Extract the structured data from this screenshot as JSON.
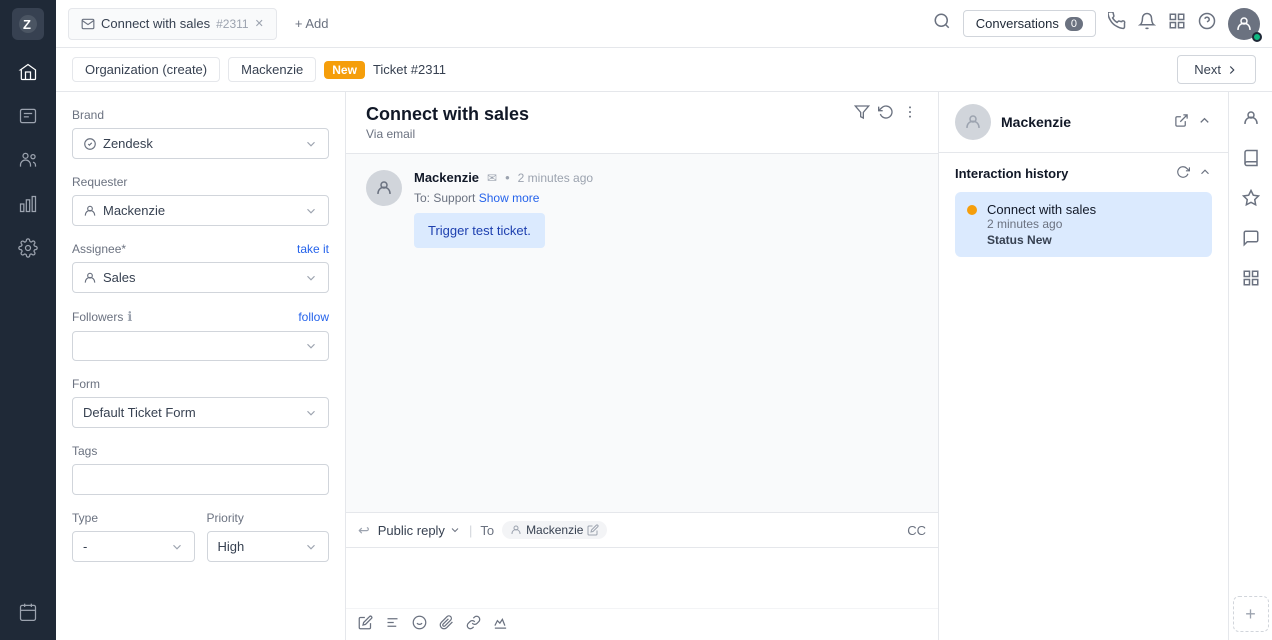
{
  "nav": {
    "logo": "Z",
    "icons": [
      "🏠",
      "📋",
      "👥",
      "📊",
      "⚙️",
      "📅"
    ]
  },
  "topbar": {
    "tab_title": "Connect with sales",
    "tab_id": "#2311",
    "add_label": "+ Add",
    "conversations_label": "Conversations",
    "conversations_count": "0"
  },
  "breadcrumb": {
    "org": "Organization (create)",
    "user": "Mackenzie",
    "status_badge": "New",
    "ticket": "Ticket #2311",
    "next_label": "Next"
  },
  "left_panel": {
    "brand_label": "Brand",
    "brand_value": "Zendesk",
    "requester_label": "Requester",
    "requester_value": "Mackenzie",
    "assignee_label": "Assignee*",
    "take_it_label": "take it",
    "assignee_value": "Sales",
    "followers_label": "Followers",
    "follow_label": "follow",
    "form_label": "Form",
    "form_value": "Default Ticket Form",
    "tags_label": "Tags",
    "type_label": "Type",
    "type_value": "-",
    "priority_label": "Priority",
    "priority_value": "High"
  },
  "center": {
    "ticket_title": "Connect with sales",
    "ticket_via": "Via email",
    "message": {
      "sender": "Mackenzie",
      "time": "2 minutes ago",
      "to": "Support",
      "show_more": "Show more",
      "body": "Trigger test ticket."
    },
    "reply": {
      "type_label": "Public reply",
      "to_label": "To",
      "recipient": "Mackenzie",
      "cc_label": "CC"
    }
  },
  "right_panel": {
    "customer_name": "Mackenzie",
    "section_title": "Interaction history",
    "interaction": {
      "title": "Connect with sales",
      "time": "2 minutes ago",
      "status_label": "Status",
      "status_value": "New"
    }
  }
}
